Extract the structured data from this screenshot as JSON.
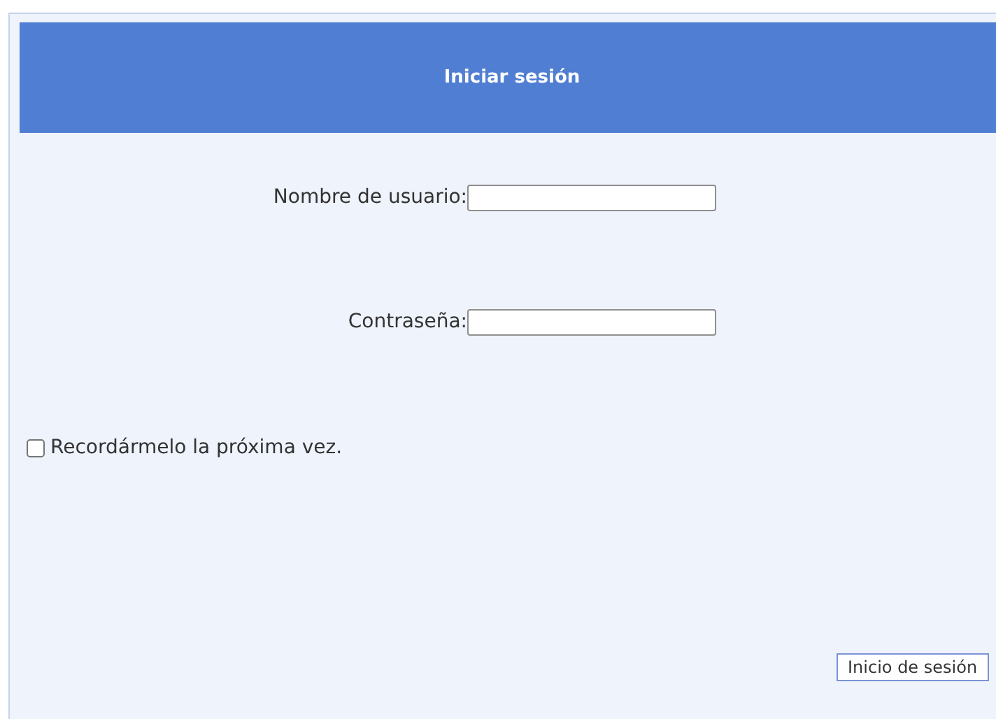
{
  "header": {
    "title": "Iniciar sesión"
  },
  "fields": [
    {
      "label": "Nombre de usuario:"
    },
    {
      "label": "Contraseña:"
    }
  ],
  "remember": {
    "label": "Recordármelo la próxima vez.",
    "checked": false
  },
  "submit": {
    "label": "Inicio de sesión"
  }
}
